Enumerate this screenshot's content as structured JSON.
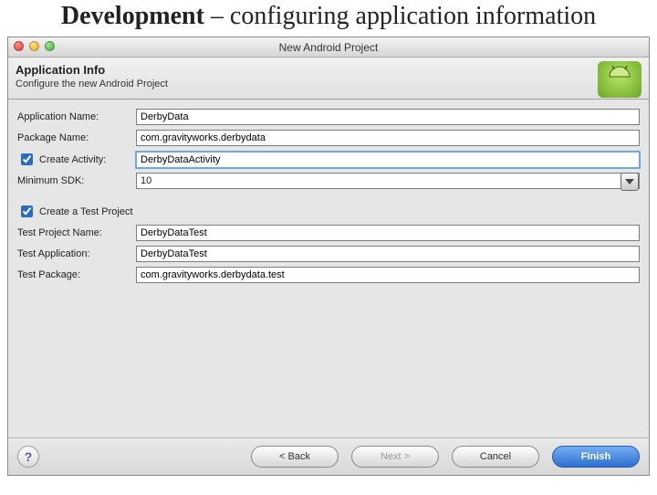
{
  "slide": {
    "title_bold": "Development",
    "title_rest": " – configuring application information"
  },
  "window": {
    "title": "New Android Project"
  },
  "header": {
    "heading": "Application Info",
    "subtitle": "Configure the new Android Project"
  },
  "form": {
    "app_name_label": "Application Name:",
    "app_name_value": "DerbyData",
    "package_label": "Package Name:",
    "package_value": "com.gravityworks.derbydata",
    "create_activity_label": "Create Activity:",
    "create_activity_value": "DerbyDataActivity",
    "min_sdk_label": "Minimum SDK:",
    "min_sdk_value": "10",
    "create_test_label": "Create a Test Project",
    "test_project_name_label": "Test Project Name:",
    "test_project_name_value": "DerbyDataTest",
    "test_application_label": "Test Application:",
    "test_application_value": "DerbyDataTest",
    "test_package_label": "Test Package:",
    "test_package_value": "com.gravityworks.derbydata.test"
  },
  "footer": {
    "back": "< Back",
    "next": "Next >",
    "cancel": "Cancel",
    "finish": "Finish"
  }
}
